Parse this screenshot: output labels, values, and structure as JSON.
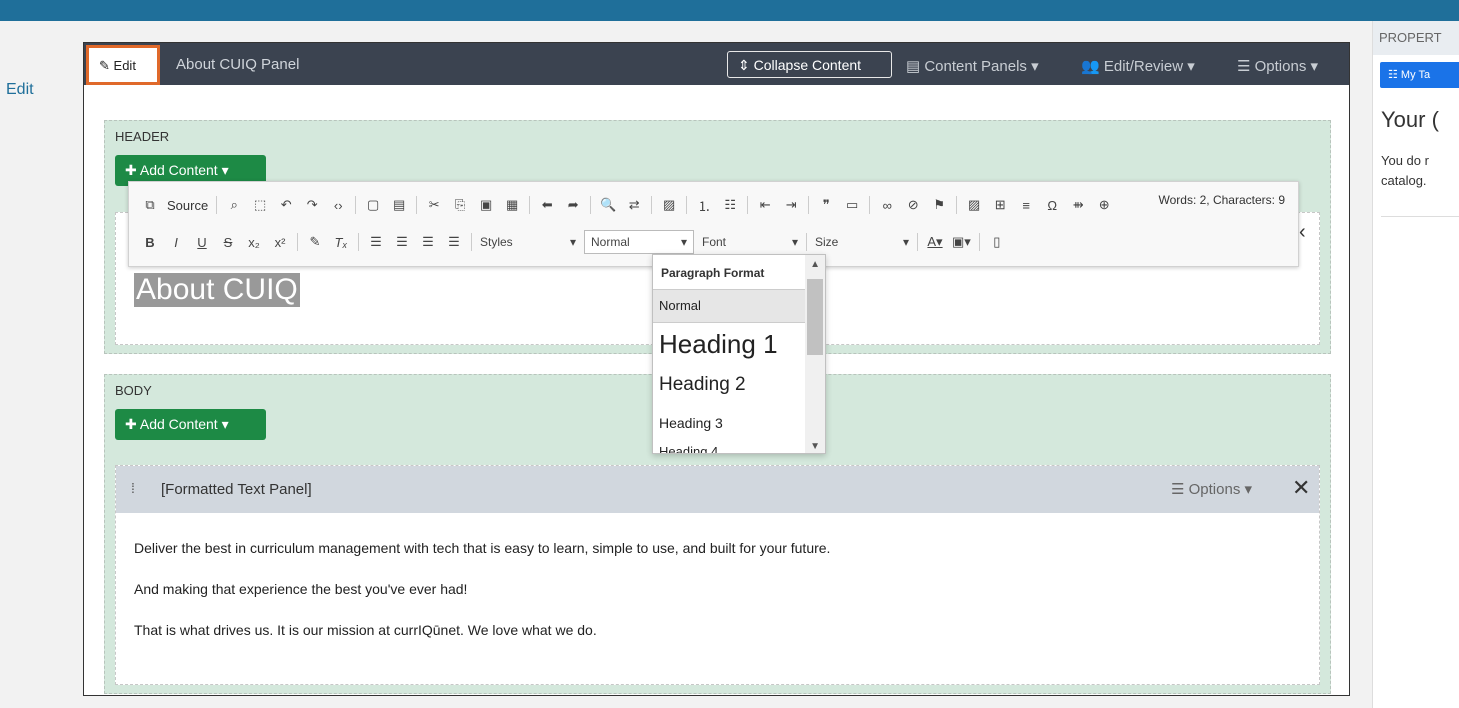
{
  "left": {
    "edit_label": "Edit"
  },
  "right_panel": {
    "header": "PROPERT",
    "my_tab": "My Ta",
    "title": "Your (",
    "text_line1": "You do r",
    "text_line2": "catalog."
  },
  "toolbar": {
    "edit_label": "Edit",
    "panel_title": "About CUIQ Panel",
    "collapse_label": "Collapse Content",
    "content_panels": "Content Panels",
    "edit_review": "Edit/Review",
    "options": "Options"
  },
  "header_section": {
    "label": "HEADER",
    "add_content": "Add Content",
    "heading_text": "About CUIQ"
  },
  "body_section": {
    "label": "BODY",
    "add_content": "Add Content"
  },
  "formatted_panel": {
    "title": "[Formatted Text Panel]",
    "options": "Options",
    "paragraphs": [
      "Deliver the best in curriculum management with tech that is easy to learn, simple to use, and built for your future.",
      "And making that experience the best you've ever had!",
      "That is what drives us. It is our mission at currIQūnet.  We love what we do."
    ]
  },
  "editor": {
    "source": "Source",
    "styles": "Styles",
    "format": "Normal",
    "font": "Font",
    "size": "Size",
    "word_count": "Words: 2, Characters: 9"
  },
  "format_dropdown": {
    "header": "Paragraph Format",
    "items": [
      "Normal",
      "Heading 1",
      "Heading 2",
      "Heading 3",
      "Heading 4"
    ]
  }
}
